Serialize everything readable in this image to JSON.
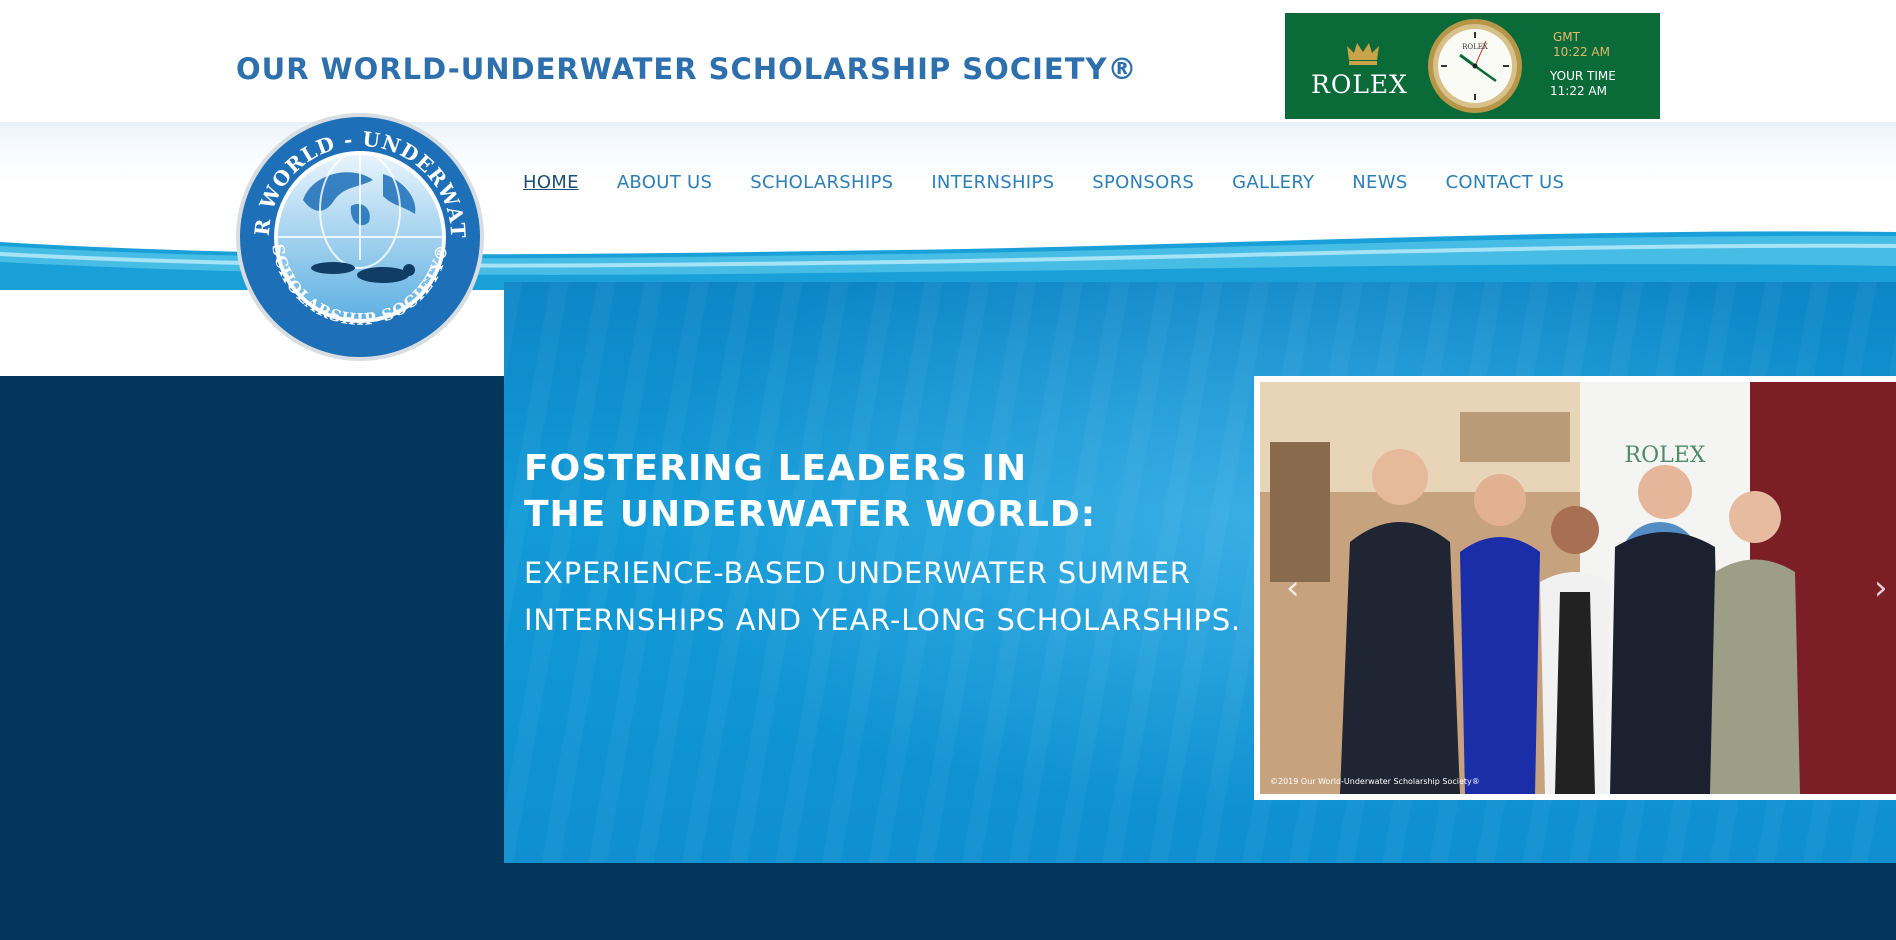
{
  "header": {
    "site_title": "OUR WORLD-UNDERWATER SCHOLARSHIP SOCIETY®"
  },
  "rolex_ad": {
    "brand": "ROLEX",
    "clock_brand": "ROLEX",
    "gmt_label": "GMT",
    "gmt_time": "10:22 AM",
    "your_time_label": "YOUR TIME",
    "your_time": "11:22 AM",
    "bg_color": "#0b6b38"
  },
  "logo": {
    "top_text": "OUR WORLD - UNDERWATER",
    "bottom_text": "SCHOLARSHIP SOCIETY®"
  },
  "nav": {
    "items": [
      {
        "label": "HOME",
        "active": true
      },
      {
        "label": "ABOUT US"
      },
      {
        "label": "SCHOLARSHIPS"
      },
      {
        "label": "INTERNSHIPS"
      },
      {
        "label": "SPONSORS"
      },
      {
        "label": "GALLERY"
      },
      {
        "label": "NEWS"
      },
      {
        "label": "CONTACT US"
      }
    ]
  },
  "hero": {
    "title_line1": "FOSTERING LEADERS IN",
    "title_line2": "THE UNDERWATER WORLD:",
    "subtitle": "EXPERIENCE-BASED UNDERWATER SUMMER INTERNSHIPS AND YEAR-LONG SCHOLARSHIPS."
  },
  "slideshow": {
    "banner_brand": "ROLEX",
    "caption": "©2019 Our World-Underwater Scholarship Society®",
    "prev_icon": "chevron-left-icon",
    "next_icon": "chevron-right-icon"
  },
  "colors": {
    "title_blue": "#2e70ad",
    "nav_blue": "#2d7fb8",
    "hero_blue": "#129ad6",
    "navy": "#04355a"
  }
}
